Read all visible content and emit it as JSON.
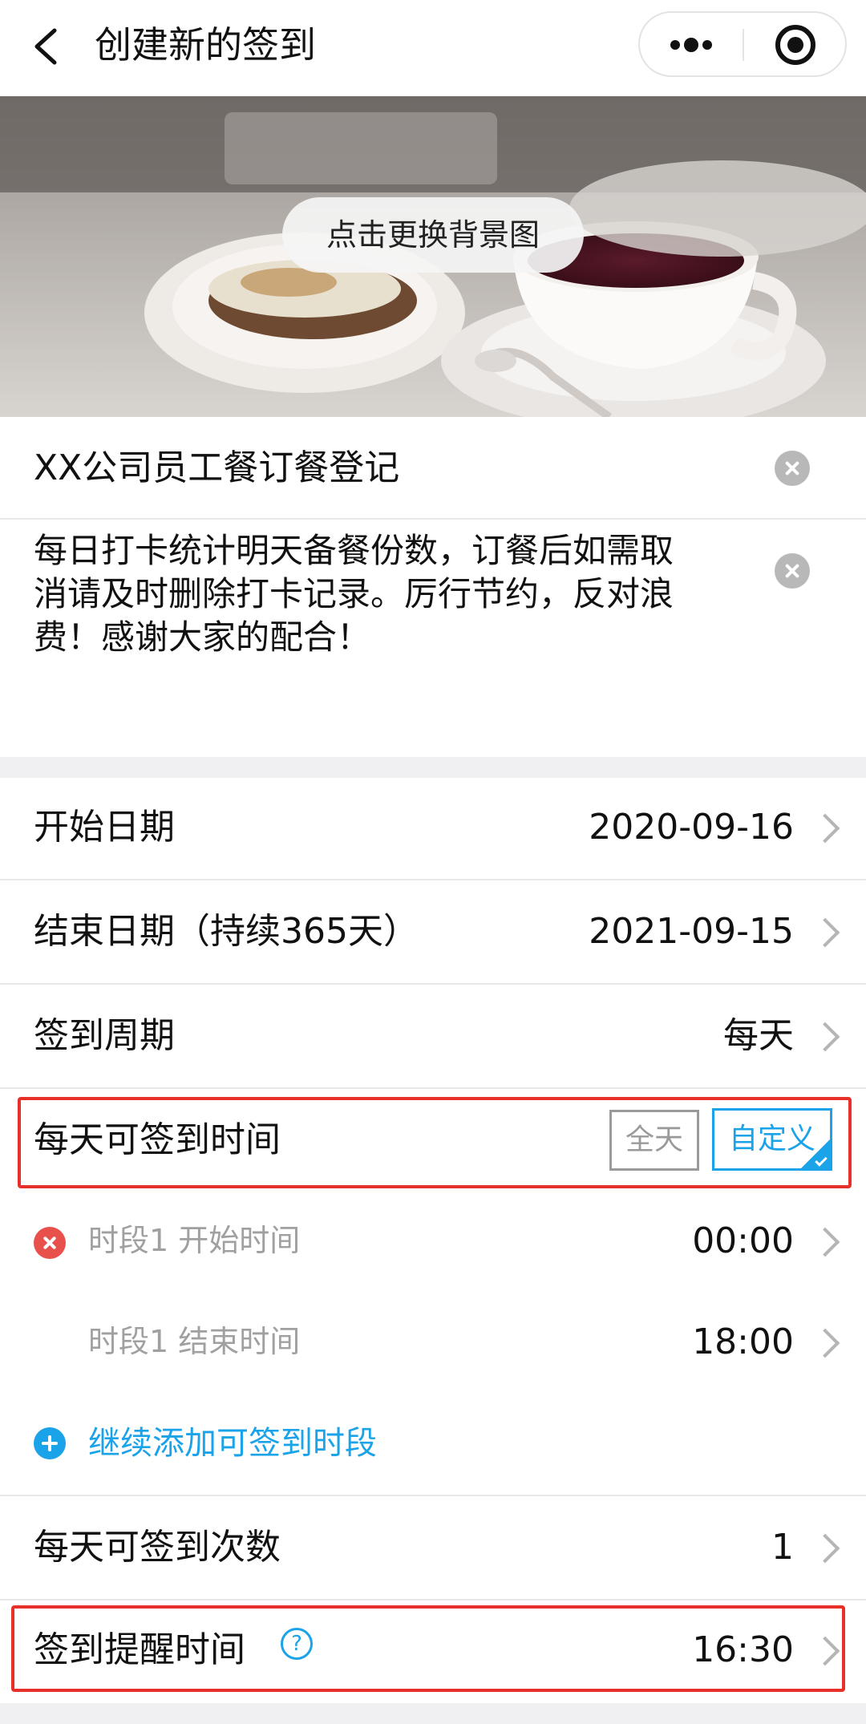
{
  "navbar": {
    "title": "创建新的签到",
    "back_icon": "chevron-left-icon",
    "more_icon": "more-dots-icon",
    "close_icon": "target-circle-icon"
  },
  "banner": {
    "change_button_label": "点击更换背景图"
  },
  "event": {
    "title": "XX公司员工餐订餐登记",
    "description": "每日打卡统计明天备餐份数，订餐后如需取消请及时删除打卡记录。厉行节约，反对浪费！感谢大家的配合！"
  },
  "settings": {
    "start_date": {
      "label": "开始日期",
      "value": "2020-09-16"
    },
    "end_date": {
      "label": "结束日期（持续365天）",
      "value": "2021-09-15"
    },
    "cycle": {
      "label": "签到周期",
      "value": "每天"
    },
    "daily_time": {
      "label": "每天可签到时间",
      "options": [
        "全天",
        "自定义"
      ],
      "selected": "自定义"
    },
    "periods": [
      {
        "start_label": "时段1 开始时间",
        "start_value": "00:00",
        "end_label": "时段1 结束时间",
        "end_value": "18:00"
      }
    ],
    "add_period_label": "继续添加可签到时段",
    "daily_count": {
      "label": "每天可签到次数",
      "value": "1"
    },
    "reminder": {
      "label": "签到提醒时间",
      "help_glyph": "?",
      "value": "16:30"
    }
  },
  "colors": {
    "accent": "#1aa3e8",
    "highlight_border": "#e8302a",
    "remove": "#e8504c",
    "muted_text": "#a0a0a0"
  }
}
